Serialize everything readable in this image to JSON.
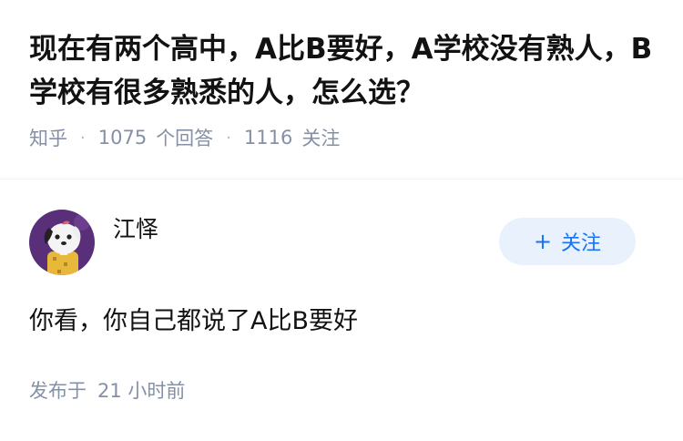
{
  "question": {
    "title": "现在有两个高中，A比B要好，A学校没有熟人，B学校有很多熟悉的人，怎么选？",
    "site": "知乎",
    "answer_count": "1075",
    "answer_count_label": "个回答",
    "follower_count": "1116",
    "follower_label": "关注"
  },
  "answer": {
    "author_name": "江怿",
    "follow_label": "关注",
    "content": "你看，你自己都说了A比B要好",
    "time_label": "发布于",
    "time_value": "21 小时前"
  },
  "colors": {
    "accent": "#1772f6",
    "button_bg": "#e8f1fc",
    "meta": "#8590a6",
    "avatar_bg": "#5a2f7a"
  },
  "icons": {
    "avatar": "cartoon-dog-avatar",
    "follow": "plus-icon"
  }
}
